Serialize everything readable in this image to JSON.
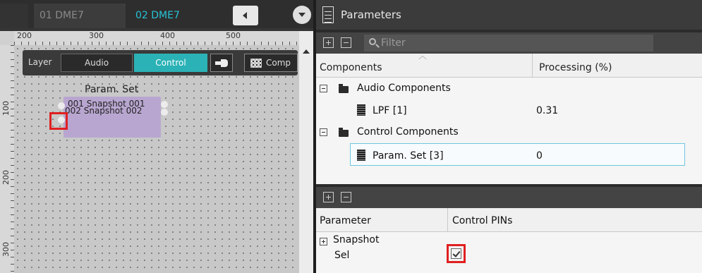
{
  "tabs": [
    {
      "label": "01 DME7"
    },
    {
      "label": "02 DME7"
    }
  ],
  "ruler": {
    "h_ticks": [
      "200",
      "300",
      "400",
      "500"
    ],
    "v_ticks": [
      "100",
      "200",
      "300"
    ]
  },
  "toolbar": {
    "layer_label": "Layer",
    "audio_label": "Audio",
    "control_label": "Control",
    "components_label": "Comp"
  },
  "canvas": {
    "block_title": "Param. Set",
    "pins": [
      "001 Snapshot 001",
      "002 Snapshot 002"
    ]
  },
  "parameters_panel": {
    "title": "Parameters",
    "filter_placeholder": "Filter",
    "columns": [
      "Components",
      "Processing (%)"
    ],
    "groups": [
      {
        "label": "Audio Components",
        "items": [
          {
            "name": "LPF [1]",
            "value": "0.31"
          }
        ]
      },
      {
        "label": "Control Components",
        "items": [
          {
            "name": "Param. Set [3]",
            "value": "0"
          }
        ]
      }
    ]
  },
  "param_list": {
    "columns": [
      "Parameter",
      "Control PINs"
    ],
    "rows": [
      {
        "label": "Snapshot"
      },
      {
        "label": "Sel",
        "checked": true
      }
    ]
  },
  "colors": {
    "accent": "#2bb2b6",
    "active_tab_text": "#27c3d6",
    "block_fill": "#b8a6d0",
    "highlight": "#e02020"
  },
  "icons": [
    "scroll-left-icon",
    "dropdown-icon",
    "plug-icon",
    "grid-icon",
    "document-icon",
    "search-icon",
    "folder-icon",
    "chip-icon",
    "checkbox-icon"
  ]
}
